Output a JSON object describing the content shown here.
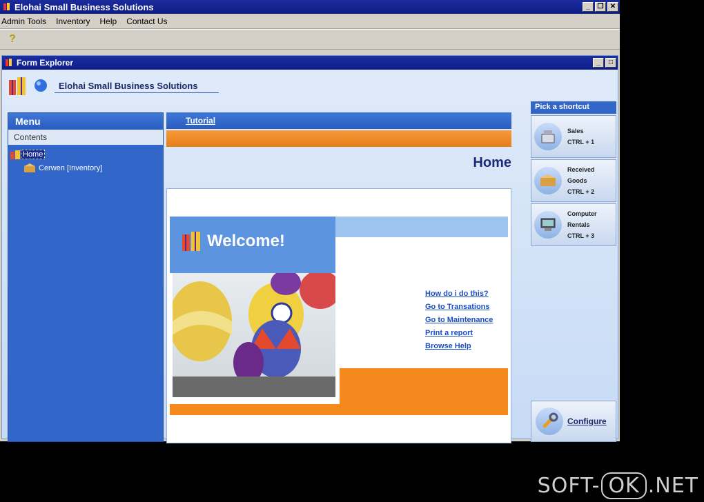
{
  "app": {
    "title": "Elohai Small Business Solutions",
    "menu": [
      "Admin Tools",
      "Inventory",
      "Help",
      "Contact Us"
    ],
    "toolbar_help_glyph": "?"
  },
  "child": {
    "title": "Form Explorer",
    "brand": "Elohai Small Business Solutions"
  },
  "menu_panel": {
    "header": "Menu",
    "contents_label": "Contents",
    "tree": [
      {
        "label": "Home"
      },
      {
        "label": "Cerwen [Inventory]"
      }
    ]
  },
  "center": {
    "tutorial_label": "Tutorial",
    "page_title": "Home",
    "welcome_text": "Welcome!",
    "links": [
      "How do i do this?",
      "Go to Transations",
      "Go to Maintenance",
      "Print a report",
      "Browse Help"
    ]
  },
  "shortcuts": {
    "header": "Pick a shortcut",
    "items": [
      {
        "line1": "Sales",
        "line2": "",
        "key": "CTRL + 1"
      },
      {
        "line1": "Received",
        "line2": "Goods",
        "key": "CTRL + 2"
      },
      {
        "line1": "Computer",
        "line2": "Rentals",
        "key": "CTRL + 3"
      }
    ],
    "configure_label": "Configure"
  },
  "watermark": {
    "left": "SOFT-",
    "mid": "OK",
    "right": ".NET"
  }
}
